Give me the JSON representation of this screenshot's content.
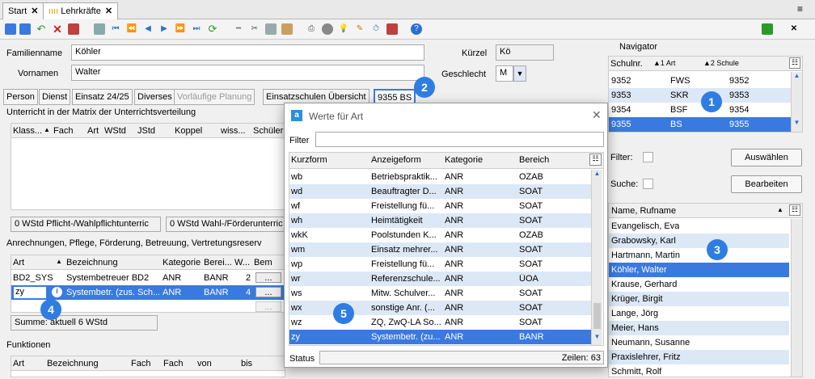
{
  "tabs": [
    {
      "label": "Start"
    },
    {
      "label": "Lehrkräfte"
    }
  ],
  "form": {
    "familienname_label": "Familienname",
    "familienname": "Köhler",
    "vornamen_label": "Vornamen",
    "vornamen": "Walter",
    "kuerzel_label": "Kürzel",
    "kuerzel": "Kö",
    "geschlecht_label": "Geschlecht",
    "geschlecht": "M"
  },
  "subtabs": [
    "Person",
    "Dienst",
    "Einsatz 24/25",
    "Diverses",
    "Vorläufige Planung",
    "Einsatzschulen Übersicht",
    "9355 BS"
  ],
  "matrix": {
    "title": "Unterricht in der Matrix der Unterrichtsverteilung",
    "cols": [
      "Klass...",
      "Fach",
      "Art",
      "WStd",
      "JStd",
      "Koppel",
      "wiss...",
      "Schüler"
    ],
    "pflicht": "0 WStd Pflicht-/Wahlpflichtunterric",
    "wahl": "0 WStd Wahl-/Förderunterric"
  },
  "anrechnungen": {
    "title": "Anrechnungen, Pflege, Förderung, Betreuung, Vertretungsreserv",
    "cols": [
      "Art",
      "Bezeichnung",
      "Kategorie",
      "Berei...",
      "W...",
      "Bem"
    ],
    "rows": [
      {
        "art": "BD2_SYS",
        "bez": "Systembetreuer BD2",
        "kat": "ANR",
        "ber": "BANR",
        "w": "2",
        "bem": "..."
      },
      {
        "art": "zy",
        "bez": "Systembetr. (zus. Sch...",
        "kat": "ANR",
        "ber": "BANR",
        "w": "4",
        "bem": "..."
      },
      {
        "art": "",
        "bez": "",
        "kat": "",
        "ber": "",
        "w": "",
        "bem": "..."
      }
    ],
    "summe": "Summe: aktuell 6 WStd"
  },
  "funktionen": {
    "title": "Funktionen",
    "cols": [
      "Art",
      "Bezeichnung",
      "Fach",
      "Fach",
      "von",
      "bis"
    ]
  },
  "navigator": {
    "title": "Navigator",
    "cols": [
      "Schulnr.",
      "▲1 Art",
      "▲2 Schule"
    ],
    "rows": [
      {
        "nr": "9352",
        "art": "FWS",
        "schule": "9352"
      },
      {
        "nr": "9353",
        "art": "SKR",
        "schule": "9353"
      },
      {
        "nr": "9354",
        "art": "BSF",
        "schule": "9354"
      },
      {
        "nr": "9355",
        "art": "BS",
        "schule": "9355"
      }
    ],
    "filter_label": "Filter:",
    "suche_label": "Suche:",
    "auswaehlen": "Auswählen",
    "bearbeiten": "Bearbeiten",
    "name_header": "Name, Rufname",
    "names": [
      "Evangelisch, Eva",
      "Grabowsky, Karl",
      "Hartmann, Martin",
      "Köhler, Walter",
      "Krause, Gerhard",
      "Krüger, Birgit",
      "Lange, Jörg",
      "Meier, Hans",
      "Neumann, Susanne",
      "Praxislehrer, Fritz",
      "Schmitt, Rolf"
    ]
  },
  "dialog": {
    "title": "Werte für Art",
    "filter_label": "Filter",
    "cols": [
      "Kurzform",
      "Anzeigeform",
      "Kategorie",
      "Bereich"
    ],
    "rows": [
      {
        "k": "wb",
        "a": "Betriebspraktik...",
        "c": "ANR",
        "b": "OZAB"
      },
      {
        "k": "wd",
        "a": "Beauftragter D...",
        "c": "ANR",
        "b": "SOAT"
      },
      {
        "k": "wf",
        "a": "Freistellung fü...",
        "c": "ANR",
        "b": "SOAT"
      },
      {
        "k": "wh",
        "a": "Heimtätigkeit",
        "c": "ANR",
        "b": "SOAT"
      },
      {
        "k": "wkK",
        "a": "Poolstunden K...",
        "c": "ANR",
        "b": "OZAB"
      },
      {
        "k": "wm",
        "a": "Einsatz mehrer...",
        "c": "ANR",
        "b": "SOAT"
      },
      {
        "k": "wp",
        "a": "Freistellung fü...",
        "c": "ANR",
        "b": "SOAT"
      },
      {
        "k": "wr",
        "a": "Referenzschule...",
        "c": "ANR",
        "b": "ÜOA"
      },
      {
        "k": "ws",
        "a": "Mitw. Schulver...",
        "c": "ANR",
        "b": "SOAT"
      },
      {
        "k": "wx",
        "a": "sonstige Anr. (...",
        "c": "ANR",
        "b": "SOAT"
      },
      {
        "k": "wz",
        "a": "ZQ, ZwQ-LA So...",
        "c": "ANR",
        "b": "SOAT"
      },
      {
        "k": "zy",
        "a": "Systembetr. (zu...",
        "c": "ANR",
        "b": "BANR"
      }
    ],
    "status_label": "Status",
    "zeilen": "Zeilen: 63"
  },
  "badges": [
    "1",
    "2",
    "3",
    "4",
    "5"
  ],
  "colors": {
    "selection": "#3a7ae0",
    "alt_row": "#dde8f6",
    "badge": "#2f7de1"
  }
}
